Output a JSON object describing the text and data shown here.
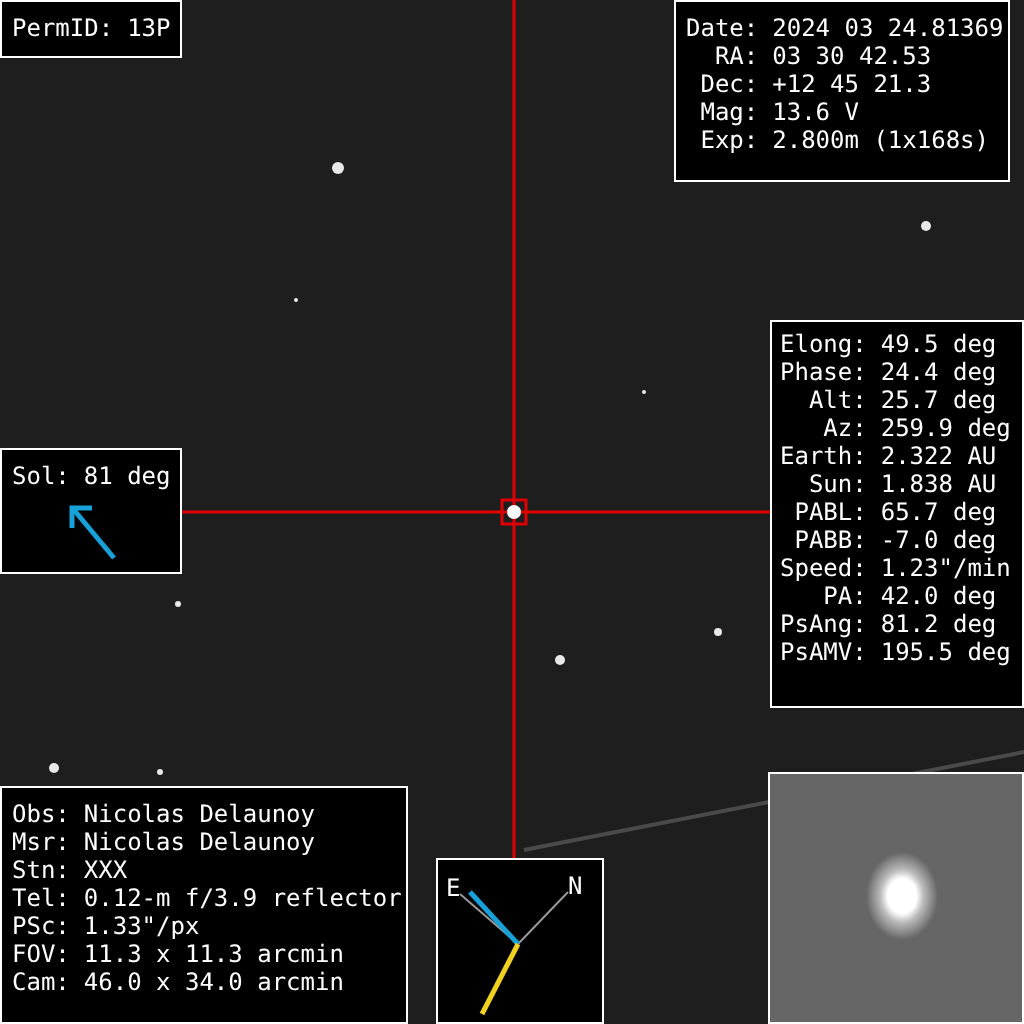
{
  "perm_id": {
    "label": "PermID:",
    "value": "13P"
  },
  "observation": [
    {
      "label": "Date:",
      "value": "2024 03 24.81369"
    },
    {
      "label": "RA:",
      "value": "03 30 42.53"
    },
    {
      "label": "Dec:",
      "value": "+12 45 21.3"
    },
    {
      "label": "Mag:",
      "value": "13.6 V"
    },
    {
      "label": "Exp:",
      "value": "2.800m (1x168s)"
    }
  ],
  "geometry": [
    {
      "label": "Elong:",
      "value": "49.5 deg"
    },
    {
      "label": "Phase:",
      "value": "24.4 deg"
    },
    {
      "label": "Alt:",
      "value": "25.7 deg"
    },
    {
      "label": "Az:",
      "value": "259.9 deg"
    },
    {
      "label": "Earth:",
      "value": "2.322 AU"
    },
    {
      "label": "Sun:",
      "value": "1.838 AU"
    },
    {
      "label": "PABL:",
      "value": "65.7 deg"
    },
    {
      "label": "PABB:",
      "value": "-7.0 deg"
    },
    {
      "label": "Speed:",
      "value": "1.23\"/min"
    },
    {
      "label": "PA:",
      "value": "42.0 deg"
    },
    {
      "label": "PsAng:",
      "value": "81.2 deg"
    },
    {
      "label": "PsAMV:",
      "value": "195.5 deg"
    }
  ],
  "sun_direction": {
    "label": "Sol:",
    "value": "81 deg"
  },
  "observer": [
    {
      "label": "Obs:",
      "value": "Nicolas Delaunoy"
    },
    {
      "label": "Msr:",
      "value": "Nicolas Delaunoy"
    },
    {
      "label": "Stn:",
      "value": "XXX"
    },
    {
      "label": "Tel:",
      "value": "0.12-m f/3.9 reflector"
    },
    {
      "label": "PSc:",
      "value": "1.33\"/px"
    },
    {
      "label": "FOV:",
      "value": "11.3 x 11.3 arcmin"
    },
    {
      "label": "Cam:",
      "value": "46.0 x 34.0 arcmin"
    }
  ],
  "compass": {
    "east": "E",
    "north": "N"
  }
}
